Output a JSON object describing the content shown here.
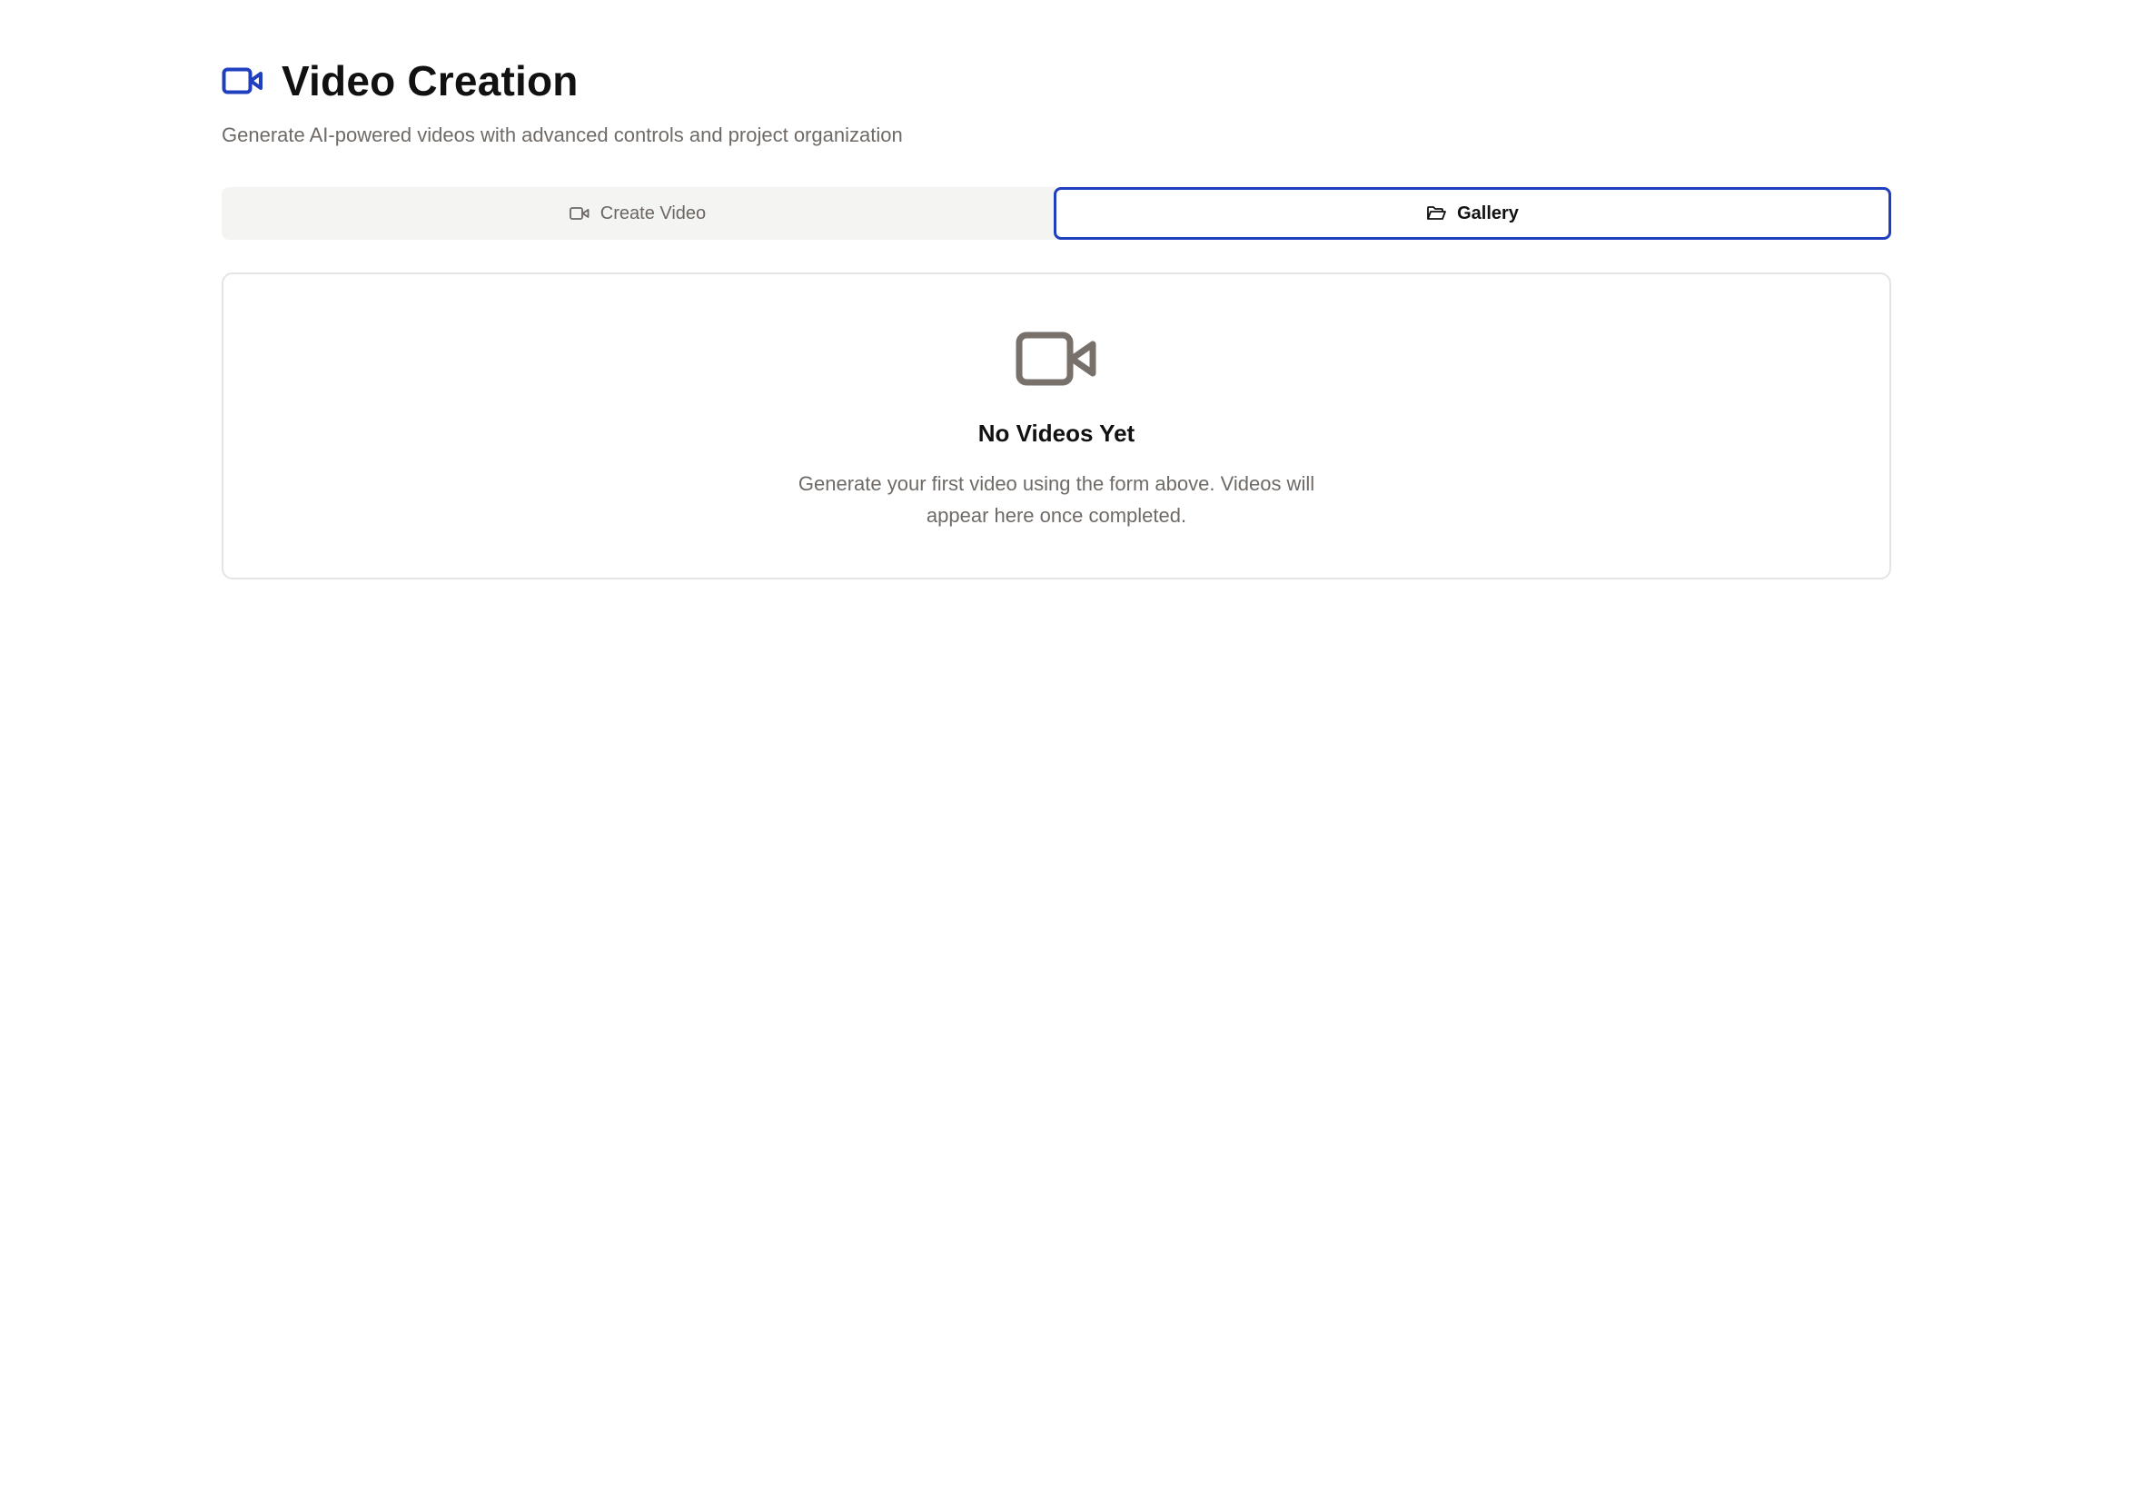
{
  "header": {
    "icon": "video-camera-icon",
    "title": "Video Creation",
    "subtitle": "Generate AI-powered videos with advanced controls and project organization"
  },
  "tabs": [
    {
      "label": "Create Video",
      "icon": "video-camera-icon",
      "active": false
    },
    {
      "label": "Gallery",
      "icon": "folder-open-icon",
      "active": true
    }
  ],
  "empty_state": {
    "icon": "video-camera-icon",
    "title": "No Videos Yet",
    "description": "Generate your first video using the form above. Videos will appear here once completed."
  },
  "colors": {
    "accent": "#1f3fbf",
    "muted_text": "#6f6a66",
    "tab_bar_bg": "#f4f4f3",
    "card_border": "#e6e4e2",
    "empty_icon": "#77706b"
  }
}
